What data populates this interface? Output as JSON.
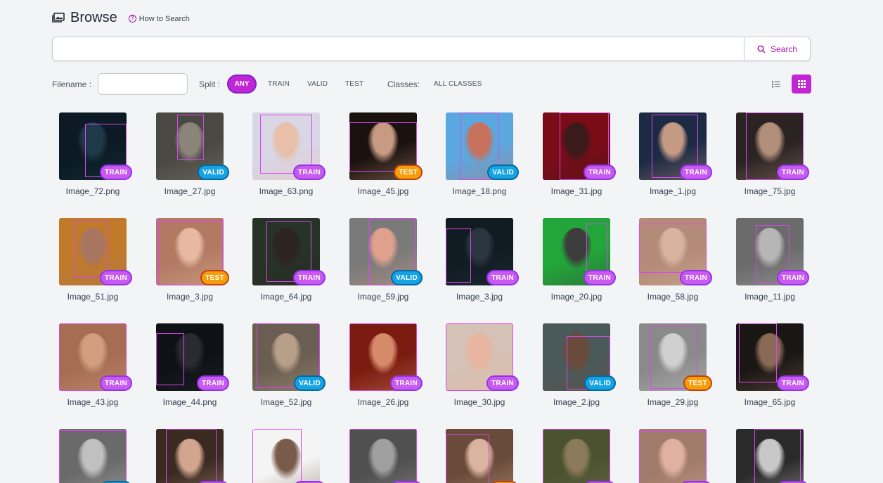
{
  "header": {
    "title": "Browse",
    "how_to": "How to Search"
  },
  "search": {
    "button_label": "Search",
    "value": ""
  },
  "filters": {
    "filename_label": "Filename :",
    "split_label": "Split :",
    "split_options": [
      "ANY",
      "TRAIN",
      "VALID",
      "TEST"
    ],
    "selected_split": "ANY",
    "classes_label": "Classes:",
    "classes_value": "ALL CLASSES"
  },
  "view": {
    "mode": "grid"
  },
  "colors": {
    "accent": "#c026d3",
    "train": "#c85af0",
    "valid": "#16a3e3",
    "test": "#f59e0b"
  },
  "images": [
    {
      "name": "Image_72.png",
      "split": "TRAIN",
      "bg": "#0b1a24",
      "fg": "#1e3a4a"
    },
    {
      "name": "Image_27.jpg",
      "split": "VALID",
      "bg": "#4a4843",
      "fg": "#8b8479"
    },
    {
      "name": "Image_63.png",
      "split": "TRAIN",
      "bg": "#d9d6e6",
      "fg": "#e8bfa9"
    },
    {
      "name": "Image_45.jpg",
      "split": "TEST",
      "bg": "#1a120e",
      "fg": "#c89a82"
    },
    {
      "name": "Image_18.png",
      "split": "VALID",
      "bg": "#5ba8e0",
      "fg": "#c8715d"
    },
    {
      "name": "Image_31.jpg",
      "split": "TRAIN",
      "bg": "#7a0c18",
      "fg": "#3a1a1a"
    },
    {
      "name": "Image_1.jpg",
      "split": "TRAIN",
      "bg": "#1c2a44",
      "fg": "#c49a84"
    },
    {
      "name": "Image_75.jpg",
      "split": "TRAIN",
      "bg": "#2a2322",
      "fg": "#b18f7a"
    },
    {
      "name": "Image_51.jpg",
      "split": "TRAIN",
      "bg": "#c07a2a",
      "fg": "#a77560"
    },
    {
      "name": "Image_3.jpg",
      "split": "TEST",
      "bg": "#b27a62",
      "fg": "#e7b9a2"
    },
    {
      "name": "Image_64.jpg",
      "split": "TRAIN",
      "bg": "#263326",
      "fg": "#2d2320"
    },
    {
      "name": "Image_59.jpg",
      "split": "VALID",
      "bg": "#7a7a7a",
      "fg": "#e0a08e"
    },
    {
      "name": "Image_3.jpg",
      "split": "TRAIN",
      "bg": "#111b22",
      "fg": "#2b3540"
    },
    {
      "name": "Image_20.jpg",
      "split": "TRAIN",
      "bg": "#22a63a",
      "fg": "#3c3c3c"
    },
    {
      "name": "Image_58.jpg",
      "split": "TRAIN",
      "bg": "#b48b78",
      "fg": "#d8b3a0"
    },
    {
      "name": "Image_11.jpg",
      "split": "TRAIN",
      "bg": "#6b6b6b",
      "fg": "#b6b6b6"
    },
    {
      "name": "Image_43.jpg",
      "split": "TRAIN",
      "bg": "#a66d52",
      "fg": "#d39e80"
    },
    {
      "name": "Image_44.png",
      "split": "TRAIN",
      "bg": "#0e1216",
      "fg": "#2a2a30"
    },
    {
      "name": "Image_52.jpg",
      "split": "VALID",
      "bg": "#6a5e52",
      "fg": "#b89f8a"
    },
    {
      "name": "Image_26.jpg",
      "split": "TRAIN",
      "bg": "#7a1a10",
      "fg": "#d78a6a"
    },
    {
      "name": "Image_30.jpg",
      "split": "TRAIN",
      "bg": "#d5c1b5",
      "fg": "#e8b5a0"
    },
    {
      "name": "Image_2.jpg",
      "split": "VALID",
      "bg": "#4a5a5a",
      "fg": "#6a4a3a"
    },
    {
      "name": "Image_29.jpg",
      "split": "TEST",
      "bg": "#8a8a8a",
      "fg": "#d0d0d0"
    },
    {
      "name": "Image_65.jpg",
      "split": "TRAIN",
      "bg": "#1a1614",
      "fg": "#8a6a56"
    },
    {
      "name": "",
      "split": "VALID",
      "bg": "#6a6a6a",
      "fg": "#c0c0c0"
    },
    {
      "name": "",
      "split": "TRAIN",
      "bg": "#3a2a22",
      "fg": "#d3a58f"
    },
    {
      "name": "",
      "split": "TRAIN",
      "bg": "#f4f4f4",
      "fg": "#7a5a4a"
    },
    {
      "name": "",
      "split": "TRAIN",
      "bg": "#505050",
      "fg": "#a0a0a0"
    },
    {
      "name": "",
      "split": "TEST",
      "bg": "#6a4a3a",
      "fg": "#dab4a0"
    },
    {
      "name": "",
      "split": "TRAIN",
      "bg": "#4a5230",
      "fg": "#8a7a5a"
    },
    {
      "name": "",
      "split": "TRAIN",
      "bg": "#a07a6a",
      "fg": "#e0b0a0"
    },
    {
      "name": "",
      "split": "TRAIN",
      "bg": "#2a2a2a",
      "fg": "#c8c8c8"
    }
  ]
}
